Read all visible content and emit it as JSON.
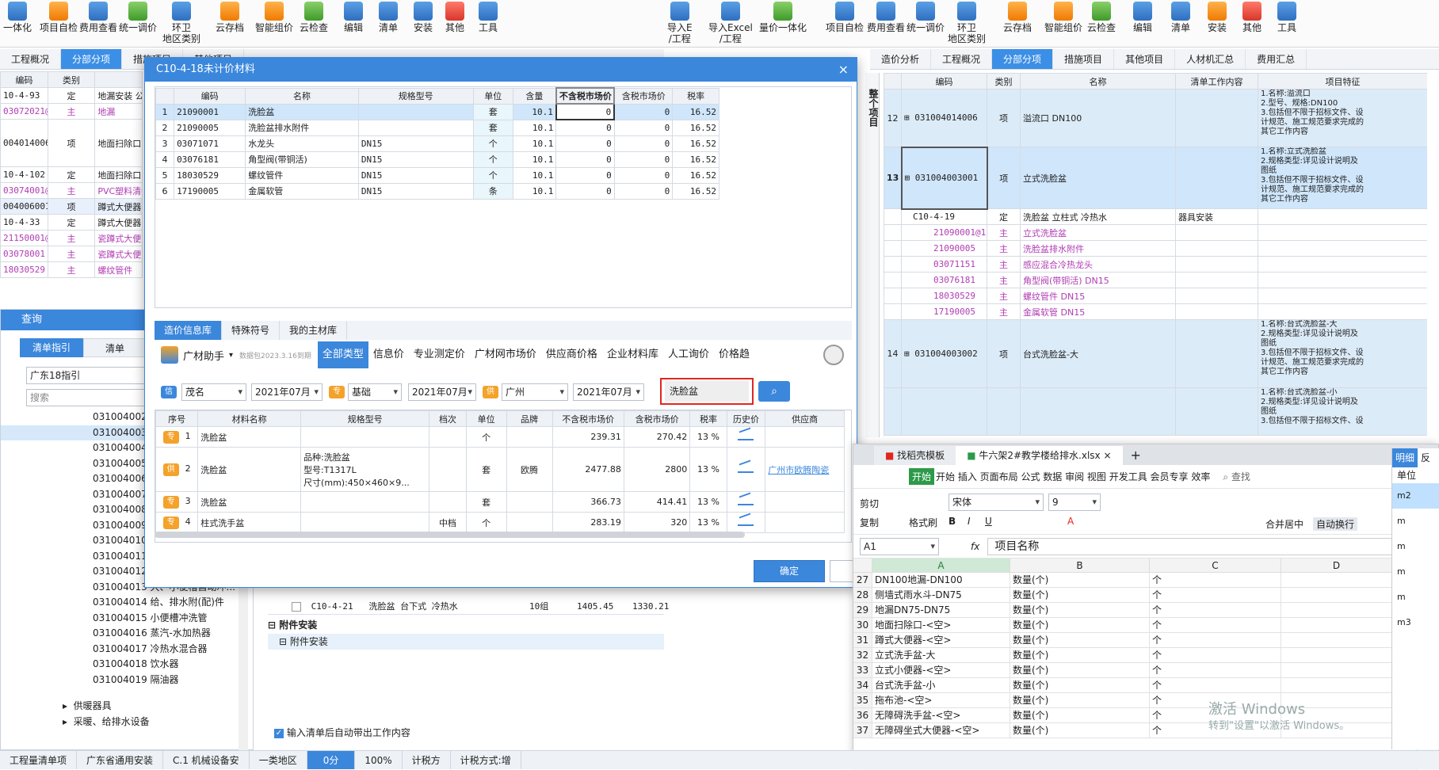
{
  "left_toolbar": {
    "items": [
      "一体化",
      "项目自检",
      "费用查看",
      "统一调价",
      "环卫\n地区类别",
      "云存档",
      "智能组价",
      "云检查",
      "编辑",
      "清单",
      "安装",
      "其他",
      "工具"
    ]
  },
  "left_tabs": [
    "工程概况",
    "分部分项",
    "措施项目",
    "其他项目"
  ],
  "left_grid": {
    "headers": [
      "编码",
      "类别"
    ],
    "rows": [
      {
        "code": "10-4-93",
        "type": "定",
        "name": "地漏安装 公"
      },
      {
        "code": "03072021@4",
        "type": "主",
        "name": "地漏",
        "purple": true
      },
      {
        "code": "004014006",
        "type": "项",
        "name": "地面扫除口"
      },
      {
        "code": "10-4-102",
        "type": "定",
        "name": "地面扫除口安"
      },
      {
        "code": "03074001@1",
        "type": "主",
        "name": "PVC塑料清扫",
        "purple": true
      },
      {
        "code": "004006001",
        "type": "项",
        "name": "蹲式大便器"
      },
      {
        "code": "10-4-33",
        "type": "定",
        "name": "蹲式大便器安"
      },
      {
        "code": "21150001@1",
        "type": "主",
        "name": "瓷蹲式大便",
        "purple": true
      },
      {
        "code": "03078001",
        "type": "主",
        "name": "瓷蹲式大便",
        "purple": true
      },
      {
        "code": "18030529",
        "type": "主",
        "name": "螺纹管件",
        "purple": true
      }
    ]
  },
  "query": {
    "title": "查询",
    "tabs": [
      "清单指引",
      "清单"
    ],
    "guide": "广东18指引",
    "search_placeholder": "搜索",
    "codes": [
      "031004002",
      "031004003",
      "031004004",
      "031004005",
      "031004006",
      "031004007",
      "031004008",
      "031004009",
      "031004010",
      "031004011",
      "031004012",
      "031004013 大、小便槽自动冲...",
      "031004014 给、排水附(配)件",
      "031004015 小便槽冲洗管",
      "031004016 蒸汽-水加热器",
      "031004017 冷热水混合器",
      "031004018 饮水器",
      "031004019 隔油器"
    ],
    "tree": [
      "供暖器具",
      "采暖、给排水设备"
    ],
    "checkbox_label": "输入清单后自动带出工作内容"
  },
  "under_dialog": {
    "row_code": "C10-4-21",
    "row_name": "洗脸盆 台下式 冷热水",
    "row_unit": "10组",
    "row_price1": "1405.45",
    "row_price2": "1330.21",
    "group1": "附件安装",
    "group2": "附件安装"
  },
  "dialog": {
    "title": "C10-4-18未计价材料",
    "close": "×",
    "headers": [
      "编码",
      "名称",
      "规格型号",
      "单位",
      "含量",
      "不含税市场价",
      "含税市场价",
      "税率"
    ],
    "rows": [
      {
        "no": "1",
        "code": "21090001",
        "name": "洗脸盆",
        "spec": "",
        "unit": "套",
        "qty": "10.1",
        "price_ex": "0",
        "price_in": "0",
        "tax": "16.52"
      },
      {
        "no": "2",
        "code": "21090005",
        "name": "洗脸盆排水附件",
        "spec": "",
        "unit": "套",
        "qty": "10.1",
        "price_ex": "0",
        "price_in": "0",
        "tax": "16.52"
      },
      {
        "no": "3",
        "code": "03071071",
        "name": "水龙头",
        "spec": "DN15",
        "unit": "个",
        "qty": "10.1",
        "price_ex": "0",
        "price_in": "0",
        "tax": "16.52"
      },
      {
        "no": "4",
        "code": "03076181",
        "name": "角型阀(带铜活)",
        "spec": "DN15",
        "unit": "个",
        "qty": "10.1",
        "price_ex": "0",
        "price_in": "0",
        "tax": "16.52"
      },
      {
        "no": "5",
        "code": "18030529",
        "name": "螺纹管件",
        "spec": "DN15",
        "unit": "个",
        "qty": "10.1",
        "price_ex": "0",
        "price_in": "0",
        "tax": "16.52"
      },
      {
        "no": "6",
        "code": "17190005",
        "name": "金属软管",
        "spec": "DN15",
        "unit": "条",
        "qty": "10.1",
        "price_ex": "0",
        "price_in": "0",
        "tax": "16.52"
      }
    ],
    "lib_tabs": [
      "造价信息库",
      "特殊符号",
      "我的主材库"
    ],
    "brand": "广材助手",
    "brand_sub": "数据包2023.3.16到期",
    "cat_tabs": [
      "全部类型",
      "信息价",
      "专业测定价",
      "广材网市场价",
      "供应商价格",
      "企业材料库",
      "人工询价",
      "价格趋"
    ],
    "filters": {
      "tag1": "信",
      "city1": "茂名",
      "month1": "2021年07月",
      "tag2": "专",
      "kind": "基础",
      "month2": "2021年07月",
      "tag3": "供",
      "city3": "广州",
      "month3": "2021年07月",
      "search": "洗脸盆"
    },
    "price_headers": [
      "序号",
      "材料名称",
      "规格型号",
      "档次",
      "单位",
      "品牌",
      "不含税市场价",
      "含税市场价",
      "税率",
      "历史价",
      "供应商"
    ],
    "price_rows": [
      {
        "tag": "专",
        "no": "1",
        "name": "洗脸盆",
        "spec": "",
        "grade": "",
        "unit": "个",
        "brand": "",
        "ex": "239.31",
        "in": "270.42",
        "tax": "13 %",
        "supplier": ""
      },
      {
        "tag": "供",
        "no": "2",
        "name": "洗脸盆",
        "spec": "品种:洗脸盆\n型号:T1317L\n尺寸(mm):450×460×9...",
        "grade": "",
        "unit": "套",
        "brand": "欧腾",
        "ex": "2477.88",
        "in": "2800",
        "tax": "13 %",
        "supplier": "广州市欧腾陶瓷"
      },
      {
        "tag": "专",
        "no": "3",
        "name": "洗脸盆",
        "spec": "",
        "grade": "",
        "unit": "套",
        "brand": "",
        "ex": "366.73",
        "in": "414.41",
        "tax": "13 %",
        "supplier": ""
      },
      {
        "tag": "专",
        "no": "4",
        "name": "柱式洗手盆",
        "spec": "",
        "grade": "中档",
        "unit": "个",
        "brand": "",
        "ex": "283.19",
        "in": "320",
        "tax": "13 %",
        "supplier": ""
      }
    ],
    "ok": "确定",
    "cancel": "取消"
  },
  "right_toolbar": {
    "items": [
      "导入E\n/工程",
      "导入Excel\n/工程",
      "量价一体化",
      "项目自检",
      "费用查看",
      "统一调价",
      "环卫\n地区类别",
      "云存档",
      "智能组价",
      "云检查",
      "编辑",
      "清单",
      "安装",
      "其他",
      "工具"
    ]
  },
  "right_tabs": [
    "造价分析",
    "工程概况",
    "分部分项",
    "措施项目",
    "其他项目",
    "人材机汇总",
    "费用汇总"
  ],
  "right_grid": {
    "headers": [
      "编码",
      "类别",
      "名称",
      "清单工作内容",
      "项目特征"
    ],
    "side_label": "整个项目",
    "rows": [
      {
        "no": "12",
        "code": "031004014006",
        "type": "项",
        "name": "溢流口 DN100",
        "work": "",
        "feat": "1.名称:溢流口\n2.型号、规格:DN100\n3.包括但不限于招标文件、设\n计规范、施工规范要求完成的\n其它工作内容",
        "kind": "item"
      },
      {
        "no": "13",
        "code": "031004003001",
        "type": "项",
        "name": "立式洗脸盆",
        "work": "",
        "feat": "1.名称:立式洗脸盆\n2.规格类型:详见设计说明及\n图纸\n3.包括但不限于招标文件、设\n计规范、施工规范要求完成的\n其它工作内容",
        "kind": "sel"
      },
      {
        "no": "",
        "code": "C10-4-19",
        "type": "定",
        "name": "洗脸盆 立柱式 冷热水",
        "work": "器具安装",
        "feat": "",
        "kind": "quota"
      },
      {
        "no": "",
        "code": "21090001@1",
        "type": "主",
        "name": "立式洗脸盆",
        "work": "",
        "feat": "",
        "kind": "main"
      },
      {
        "no": "",
        "code": "21090005",
        "type": "主",
        "name": "洗脸盆排水附件",
        "work": "",
        "feat": "",
        "kind": "main"
      },
      {
        "no": "",
        "code": "03071151",
        "type": "主",
        "name": "感应混合冷热龙头",
        "work": "",
        "feat": "",
        "kind": "main"
      },
      {
        "no": "",
        "code": "03076181",
        "type": "主",
        "name": "角型阀(带铜活) DN15",
        "work": "",
        "feat": "",
        "kind": "main"
      },
      {
        "no": "",
        "code": "18030529",
        "type": "主",
        "name": "螺纹管件 DN15",
        "work": "",
        "feat": "",
        "kind": "main"
      },
      {
        "no": "",
        "code": "17190005",
        "type": "主",
        "name": "金属软管 DN15",
        "work": "",
        "feat": "",
        "kind": "main"
      },
      {
        "no": "14",
        "code": "031004003002",
        "type": "项",
        "name": "台式洗脸盆-大",
        "work": "",
        "feat": "1.名称:台式洗脸盆-大\n2.规格类型:详见设计说明及\n图纸\n3.包括但不限于招标文件、设\n计规范、施工规范要求完成的\n其它工作内容",
        "kind": "item"
      },
      {
        "no": "",
        "code": "",
        "type": "",
        "name": "",
        "work": "",
        "feat": "1.名称:台式洗脸盆-小\n2.规格类型:详见设计说明及\n图纸\n3.包括但不限于招标文件、设",
        "kind": "item"
      }
    ]
  },
  "excel": {
    "tab1": "找稻壳模板",
    "tab2": "牛六架2#教学楼给排水.xlsx",
    "menu": "开始 插入 页面布局 公式 数据 审阅 视图 开发工具 会员专享 效率",
    "search": "查找",
    "font": "宋体",
    "size": "9",
    "cell": "A1",
    "formula": "项目名称",
    "cols": [
      "A",
      "B",
      "C",
      "D"
    ],
    "ribbon": [
      "剪切",
      "复制",
      "格式刷",
      "合并居中",
      "自动换行"
    ],
    "rows": [
      {
        "n": "27",
        "a": "DN100地漏-DN100",
        "b": "数量(个)",
        "c": "个"
      },
      {
        "n": "28",
        "a": "侧墙式雨水斗-DN75",
        "b": "数量(个)",
        "c": "个"
      },
      {
        "n": "29",
        "a": "地漏DN75-DN75",
        "b": "数量(个)",
        "c": "个"
      },
      {
        "n": "30",
        "a": "地面扫除口-<空>",
        "b": "数量(个)",
        "c": "个"
      },
      {
        "n": "31",
        "a": "蹲式大便器-<空>",
        "b": "数量(个)",
        "c": "个"
      },
      {
        "n": "32",
        "a": "立式洗手盆-大",
        "b": "数量(个)",
        "c": "个"
      },
      {
        "n": "33",
        "a": "立式小便器-<空>",
        "b": "数量(个)",
        "c": "个"
      },
      {
        "n": "34",
        "a": "台式洗手盆-小",
        "b": "数量(个)",
        "c": "个"
      },
      {
        "n": "35",
        "a": "拖布池-<空>",
        "b": "数量(个)",
        "c": "个"
      },
      {
        "n": "36",
        "a": "无障碍洗手盆-<空>",
        "b": "数量(个)",
        "c": "个"
      },
      {
        "n": "37",
        "a": "无障碍坐式大便器-<空>",
        "b": "数量(个)",
        "c": "个"
      }
    ],
    "watermark1": "激活 Windows",
    "watermark2": "转到\"设置\"以激活 Windows。"
  },
  "right_side": {
    "tab1": "明细",
    "tab2": "反",
    "unit_header": "单位",
    "units": [
      "m2",
      "m",
      "m",
      "m",
      "m",
      "m3"
    ]
  },
  "status": [
    "工程量清单项",
    "广东省通用安装",
    "C.1 机械设备安",
    "一类地区",
    "0分",
    "100%",
    "计税方",
    "计税方式:增"
  ],
  "colors": {
    "accent": "#3b87dc",
    "purple": "#b03cb3",
    "highlight": "#e0271e"
  }
}
